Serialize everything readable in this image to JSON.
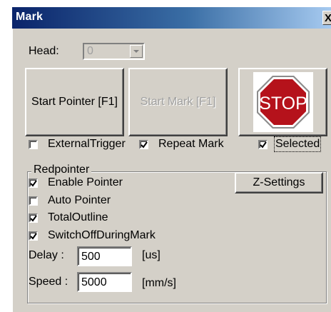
{
  "window": {
    "title": "Mark",
    "close_label": "X"
  },
  "head": {
    "label": "Head:",
    "value": "0"
  },
  "buttons": {
    "start_pointer": "Start Pointer [F1]",
    "start_mark": "Start Mark [F1]",
    "stop": "STOP"
  },
  "options": {
    "external_trigger": {
      "label": "ExternalTrigger",
      "checked": false
    },
    "repeat_mark": {
      "label": "Repeat Mark",
      "checked": true
    },
    "selected": {
      "label": "Selected",
      "checked": true
    }
  },
  "redpointer": {
    "title": "Redpointer",
    "z_settings": "Z-Settings",
    "enable_pointer": {
      "label": "Enable Pointer",
      "checked": true
    },
    "auto_pointer": {
      "label": "Auto Pointer",
      "checked": false
    },
    "total_outline": {
      "label": "TotalOutline",
      "checked": true
    },
    "switch_off": {
      "label": "SwitchOffDuringMark",
      "checked": true
    },
    "delay": {
      "label": "Delay :",
      "value": "500",
      "unit": "[us]"
    },
    "speed": {
      "label": "Speed :",
      "value": "5000",
      "unit": "[mm/s]"
    }
  },
  "colors": {
    "stop_red": "#b5121b",
    "face": "#d4d0c8",
    "title_blue": "#0a246a"
  }
}
